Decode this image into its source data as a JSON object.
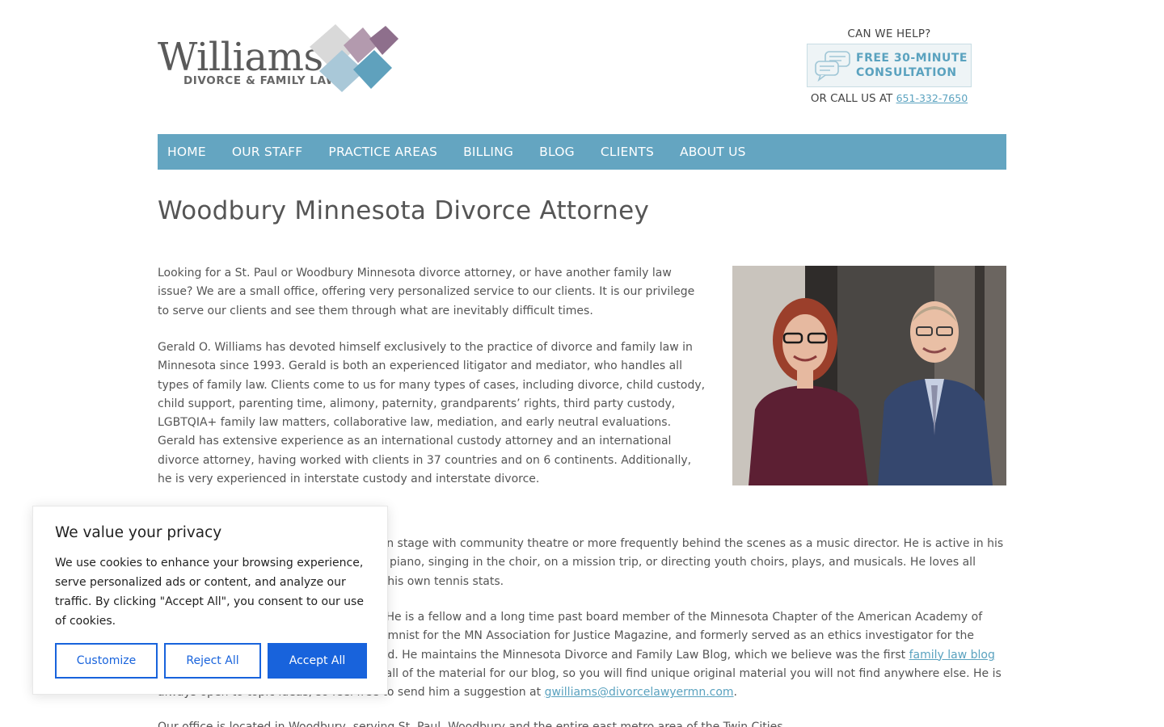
{
  "header": {
    "logo_name": "Williams",
    "logo_tagline": "DIVORCE & FAMILY LAW",
    "help_title": "CAN WE HELP?",
    "consult_line1": "FREE 30-MINUTE",
    "consult_line2": "CONSULTATION",
    "call_prefix": "OR CALL US AT",
    "phone": "651-332-7650"
  },
  "nav": {
    "items": [
      {
        "label": "HOME"
      },
      {
        "label": "OUR STAFF"
      },
      {
        "label": "PRACTICE AREAS"
      },
      {
        "label": "BILLING"
      },
      {
        "label": "BLOG"
      },
      {
        "label": "CLIENTS"
      },
      {
        "label": "ABOUT US"
      }
    ]
  },
  "main": {
    "title": "Woodbury Minnesota Divorce Attorney",
    "p1": "Looking for a St. Paul or Woodbury Minnesota divorce attorney, or have another family law issue? We are a small office, offering very personalized service to our clients.  It is our privilege to serve our clients and see them through what are inevitably difficult times.",
    "p2": "Gerald O. Williams has devoted himself exclusively to the practice of divorce and family law in Minnesota since 1993.  Gerald is both an experienced litigator and mediator, who handles all types of family law.  Clients come to us for many types of cases, including divorce, child custody, child support, parenting time, alimony, paternity, grandparents’ rights, third party custody, LGBTQIA+ family law matters, collaborative law, mediation, and early neutral evaluations. Gerald has extensive experience as an international custody attorney and an international divorce attorney, having worked with clients in 37 countries and on 6 continents. Additionally, he is very experienced in interstate custody and interstate divorce.",
    "p3": "Outside of work, you might see Gerald on stage with community theatre or more frequently behind the scenes as a music director. He is active in his church, where you might find him at the piano, singing in the choir, on a mission trip, or directing youth choirs, plays, and musicals. He loves all sports and plays tennis, always keeping his own tennis stats.",
    "p4_a": "Gerald is active in the legal community. He is a fellow and a long time past board member of the Minnesota Chapter of the American Academy of Matrimonial Lawyers. He was also a columnist for the MN Association for Justice Magazine, and formerly served as an ethics investigator for the Lawyers Professional Responsibility Board. He maintains the Minnesota Divorce and Family Law Blog, which we believe was the first",
    "p4_link": "family law blog",
    "p4_b": "in the state of Minnesota. Gerald writes all of the material for our blog, so you will find unique original material you will not find anywhere else.  He is always open to topic ideas, so feel free to send him a suggestion at",
    "p4_email": "gwilliams@divorcelawyermn.com",
    "p4_c": ".",
    "p5": "Our office is located in Woodbury, serving St. Paul, Woodbury and the entire east metro area of the Twin Cities."
  },
  "cookie": {
    "title": "We value your privacy",
    "text": "We use cookies to enhance your browsing experience, serve personalized ads or content, and analyze our traffic. By clicking \"Accept All\", you consent to our use of cookies.",
    "customize": "Customize",
    "reject": "Reject All",
    "accept": "Accept All"
  },
  "colors": {
    "nav_bg": "#64a5c1",
    "link": "#5aa2bf",
    "cookie_button": "#1863dc"
  }
}
